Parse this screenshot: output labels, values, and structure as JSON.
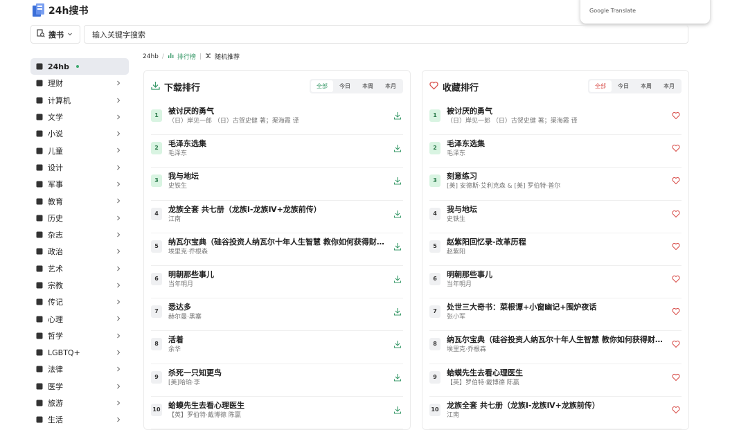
{
  "app": {
    "logo_text": "24h搜书"
  },
  "translate_popup": {
    "text": "Google Translate"
  },
  "search": {
    "type_label": "搜书",
    "value": "输入关键字搜索"
  },
  "sidebar": {
    "items": [
      {
        "label": "24hb",
        "icon": "book-icon",
        "active": true
      },
      {
        "label": "理财",
        "icon": "money-icon"
      },
      {
        "label": "计算机",
        "icon": "computer-icon"
      },
      {
        "label": "文学",
        "icon": "open-book-icon"
      },
      {
        "label": "小说",
        "icon": "chat-icon"
      },
      {
        "label": "儿童",
        "icon": "child-icon"
      },
      {
        "label": "设计",
        "icon": "ruler-icon"
      },
      {
        "label": "军事",
        "icon": "plane-icon"
      },
      {
        "label": "教育",
        "icon": "graduation-cap-icon"
      },
      {
        "label": "历史",
        "icon": "history-icon"
      },
      {
        "label": "杂志",
        "icon": "newspaper-icon"
      },
      {
        "label": "政治",
        "icon": "building-columns-icon"
      },
      {
        "label": "艺术",
        "icon": "palette-icon"
      },
      {
        "label": "宗教",
        "icon": "cross-icon"
      },
      {
        "label": "传记",
        "icon": "user-tie-icon"
      },
      {
        "label": "心理",
        "icon": "brain-icon"
      },
      {
        "label": "哲学",
        "icon": "scale-icon"
      },
      {
        "label": "LGBTQ+",
        "icon": "venus-icon"
      },
      {
        "label": "法律",
        "icon": "balance-icon"
      },
      {
        "label": "医学",
        "icon": "doctor-icon"
      },
      {
        "label": "旅游",
        "icon": "suitcase-icon"
      },
      {
        "label": "生活",
        "icon": "home-icon"
      }
    ]
  },
  "breadcrumb": {
    "home": "24hb",
    "sep": "/",
    "ranking": "排行榜",
    "divider": "|",
    "random": "随机推荐"
  },
  "download_panel": {
    "title": "下载排行",
    "tabs": [
      "全部",
      "今日",
      "本周",
      "本月"
    ],
    "rows": [
      {
        "rank": "1",
        "title": "被讨厌的勇气",
        "author": "（日）岸见一郎 （日）古贺史健 著；渠海霞 译"
      },
      {
        "rank": "2",
        "title": "毛泽东选集",
        "author": "毛泽东"
      },
      {
        "rank": "3",
        "title": "我与地坛",
        "author": "史铁生"
      },
      {
        "rank": "4",
        "title": "龙族全套 共七册（龙族Ⅰ-龙族Ⅳ+龙族前传）",
        "author": "江南"
      },
      {
        "rank": "5",
        "title": "纳瓦尔宝典（硅谷投资人纳瓦尔十年人生智慧 教你如何获得财富与幸福）",
        "author": "埃里克·乔根森"
      },
      {
        "rank": "6",
        "title": "明朝那些事儿",
        "author": "当年明月"
      },
      {
        "rank": "7",
        "title": "悉达多",
        "author": "赫尔曼·黑塞"
      },
      {
        "rank": "8",
        "title": "活着",
        "author": "余华"
      },
      {
        "rank": "9",
        "title": "杀死一只知更鸟",
        "author": "[美]哈珀·李"
      },
      {
        "rank": "10",
        "title": "蛤蟆先生去看心理医生",
        "author": "【英】罗伯特·戴博德 陈赢"
      }
    ]
  },
  "favorite_panel": {
    "title": "收藏排行",
    "tabs": [
      "全部",
      "今日",
      "本周",
      "本月"
    ],
    "rows": [
      {
        "rank": "1",
        "title": "被讨厌的勇气",
        "author": "（日）岸见一郎 （日）古贺史健 著；渠海霞 译"
      },
      {
        "rank": "2",
        "title": "毛泽东选集",
        "author": "毛泽东"
      },
      {
        "rank": "3",
        "title": "刻意练习",
        "author": "[美] 安德斯·艾利克森 & [美] 罗伯特·普尔"
      },
      {
        "rank": "4",
        "title": "我与地坛",
        "author": "史铁生"
      },
      {
        "rank": "5",
        "title": "赵紫阳回忆录-改革历程",
        "author": "赵紫阳"
      },
      {
        "rank": "6",
        "title": "明朝那些事儿",
        "author": "当年明月"
      },
      {
        "rank": "7",
        "title": "处世三大奇书：菜根谭+小窗幽记+围炉夜话",
        "author": "张小军"
      },
      {
        "rank": "8",
        "title": "纳瓦尔宝典（硅谷投资人纳瓦尔十年人生智慧 教你如何获得财富与幸福）",
        "author": "埃里克·乔根森"
      },
      {
        "rank": "9",
        "title": "蛤蟆先生去看心理医生",
        "author": "【英】罗伯特·戴博德 陈赢"
      },
      {
        "rank": "10",
        "title": "龙族全套 共七册（龙族Ⅰ-龙族Ⅳ+龙族前传）",
        "author": "江南"
      }
    ]
  },
  "colors": {
    "accent_green": "#3a9a6a",
    "accent_red": "#d9534f"
  }
}
